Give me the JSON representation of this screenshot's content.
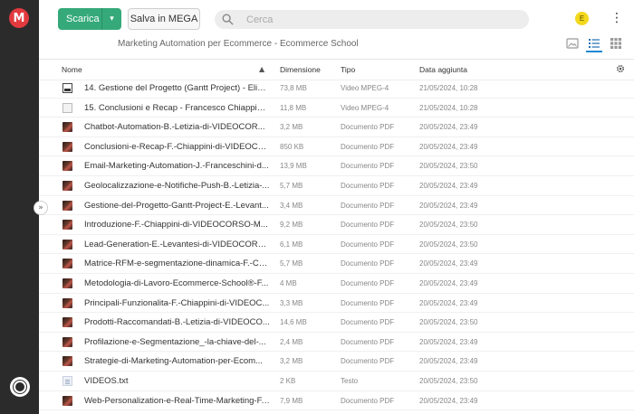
{
  "brand": {
    "logo_letter": "M",
    "accent": "#e23a3f",
    "green": "#35a97a"
  },
  "toolbar": {
    "download_label": "Scarica",
    "download_caret": "▾",
    "save_label": "Salva in MEGA",
    "search_placeholder": "Cerca",
    "avatar_letter": "E",
    "menu_glyph": "⋮"
  },
  "breadcrumb": {
    "text": "Marketing Automation per Ecommerce - Ecommerce School"
  },
  "view_modes": [
    "thumbnail-view-icon",
    "list-view-icon",
    "grid-view-icon"
  ],
  "table": {
    "columns": {
      "name": "Nome",
      "size": "Dimensione",
      "type": "Tipo",
      "date": "Data aggiunta"
    },
    "sort_glyph": "▲",
    "rows": [
      {
        "thumb": "vid",
        "name": "14. Gestione del Progetto (Gantt Project) - Elisa...",
        "size": "73,8 MB",
        "type": "Video MPEG-4",
        "date": "21/05/2024, 10:28"
      },
      {
        "thumb": "vid2",
        "name": "15. Conclusioni e Recap - Francesco Chiappini....",
        "size": "11,8 MB",
        "type": "Video MPEG-4",
        "date": "21/05/2024, 10:28"
      },
      {
        "thumb": "img",
        "name": "Chatbot-Automation-B.-Letizia-di-VIDEOCOR...",
        "size": "3,2 MB",
        "type": "Documento PDF",
        "date": "20/05/2024, 23:49"
      },
      {
        "thumb": "img",
        "name": "Conclusioni-e-Recap-F.-Chiappini-di-VIDEOCO...",
        "size": "850 KB",
        "type": "Documento PDF",
        "date": "20/05/2024, 23:49"
      },
      {
        "thumb": "img",
        "name": "Email-Marketing-Automation-J.-Franceschini-d...",
        "size": "13,9 MB",
        "type": "Documento PDF",
        "date": "20/05/2024, 23:50"
      },
      {
        "thumb": "img",
        "name": "Geolocalizzazione-e-Notifiche-Push-B.-Letizia-...",
        "size": "5,7 MB",
        "type": "Documento PDF",
        "date": "20/05/2024, 23:49"
      },
      {
        "thumb": "img",
        "name": "Gestione-del-Progetto-Gantt-Project-E.-Levant...",
        "size": "3,4 MB",
        "type": "Documento PDF",
        "date": "20/05/2024, 23:49"
      },
      {
        "thumb": "img",
        "name": "Introduzione-F.-Chiappini-di-VIDEOCORSO-M...",
        "size": "9,2 MB",
        "type": "Documento PDF",
        "date": "20/05/2024, 23:50"
      },
      {
        "thumb": "img",
        "name": "Lead-Generation-E.-Levantesi-di-VIDEOCORS...",
        "size": "6,1 MB",
        "type": "Documento PDF",
        "date": "20/05/2024, 23:50"
      },
      {
        "thumb": "img",
        "name": "Matrice-RFM-e-segmentazione-dinamica-F.-Ch...",
        "size": "5,7 MB",
        "type": "Documento PDF",
        "date": "20/05/2024, 23:49"
      },
      {
        "thumb": "img",
        "name": "Metodologia-di-Lavoro-Ecommerce-School®-F...",
        "size": "4 MB",
        "type": "Documento PDF",
        "date": "20/05/2024, 23:49"
      },
      {
        "thumb": "img",
        "name": "Principali-Funzionalita-F.-Chiappini-di-VIDEOC...",
        "size": "3,3 MB",
        "type": "Documento PDF",
        "date": "20/05/2024, 23:49"
      },
      {
        "thumb": "img",
        "name": "Prodotti-Raccomandati-B.-Letizia-di-VIDEOCO...",
        "size": "14,6 MB",
        "type": "Documento PDF",
        "date": "20/05/2024, 23:50"
      },
      {
        "thumb": "img",
        "name": "Profilazione-e-Segmentazione_-la-chiave-del-...",
        "size": "2,4 MB",
        "type": "Documento PDF",
        "date": "20/05/2024, 23:49"
      },
      {
        "thumb": "img",
        "name": "Strategie-di-Marketing-Automation-per-Ecom...",
        "size": "3,2 MB",
        "type": "Documento PDF",
        "date": "20/05/2024, 23:49"
      },
      {
        "thumb": "doc",
        "name": "VIDEOS.txt",
        "size": "2 KB",
        "type": "Testo",
        "date": "20/05/2024, 23:50"
      },
      {
        "thumb": "img",
        "name": "Web-Personalization-e-Real-Time-Marketing-F....",
        "size": "7,9 MB",
        "type": "Documento PDF",
        "date": "20/05/2024, 23:49"
      }
    ]
  },
  "sidebar": {
    "collapse_glyph": "»"
  }
}
